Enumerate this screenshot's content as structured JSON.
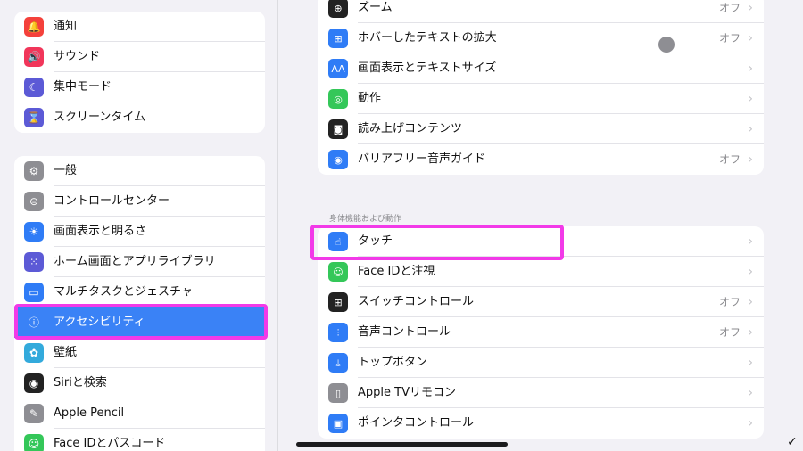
{
  "colors": {
    "accent": "#3a82f6",
    "highlight": "#f23ae8",
    "background": "#f2f1f6"
  },
  "sidebar": {
    "group1": [
      {
        "label": "通知",
        "icon": "bell-icon",
        "color": "#f4413b",
        "glyph": "🔔"
      },
      {
        "label": "サウンド",
        "icon": "speaker-icon",
        "color": "#f1365a",
        "glyph": "🔊"
      },
      {
        "label": "集中モード",
        "icon": "moon-icon",
        "color": "#5c5ad6",
        "glyph": "☾"
      },
      {
        "label": "スクリーンタイム",
        "icon": "hourglass-icon",
        "color": "#5c5ad6",
        "glyph": "⌛"
      }
    ],
    "group2": [
      {
        "label": "一般",
        "icon": "gear-icon",
        "color": "#8e8e93",
        "glyph": "⚙"
      },
      {
        "label": "コントロールセンター",
        "icon": "toggles-icon",
        "color": "#8e8e93",
        "glyph": "⊜"
      },
      {
        "label": "画面表示と明るさ",
        "icon": "sun-icon",
        "color": "#2f7cf6",
        "glyph": "☀"
      },
      {
        "label": "ホーム画面とアプリライブラリ",
        "icon": "app-grid-icon",
        "color": "#5c5ad6",
        "glyph": "⁙"
      },
      {
        "label": "マルチタスクとジェスチャ",
        "icon": "multitask-icon",
        "color": "#2f7cf6",
        "glyph": "▭"
      },
      {
        "label": "アクセシビリティ",
        "icon": "accessibility-icon",
        "color": "#2f7cf6",
        "glyph": "ⓘ",
        "selected": true
      },
      {
        "label": "壁紙",
        "icon": "flower-icon",
        "color": "#33aadc",
        "glyph": "✿"
      },
      {
        "label": "Siriと検索",
        "icon": "siri-icon",
        "color": "#222222",
        "glyph": "◉"
      },
      {
        "label": "Apple Pencil",
        "icon": "pencil-icon",
        "color": "#8e8e93",
        "glyph": "✎"
      },
      {
        "label": "Face IDとパスコード",
        "icon": "faceid-icon",
        "color": "#34c759",
        "glyph": "☺"
      }
    ]
  },
  "main": {
    "vision_group": [
      {
        "label": "ズーム",
        "icon": "zoom-icon",
        "color": "#222222",
        "glyph": "⊕",
        "value": "オフ"
      },
      {
        "label": "ホバーしたテキストの拡大",
        "icon": "hover-text-icon",
        "color": "#2f7cf6",
        "glyph": "⊞",
        "value": "オフ"
      },
      {
        "label": "画面表示とテキストサイズ",
        "icon": "text-size-icon",
        "color": "#2f7cf6",
        "glyph": "AA",
        "value": ""
      },
      {
        "label": "動作",
        "icon": "motion-icon",
        "color": "#34c759",
        "glyph": "◎",
        "value": ""
      },
      {
        "label": "読み上げコンテンツ",
        "icon": "speech-icon",
        "color": "#222222",
        "glyph": "◙",
        "value": ""
      },
      {
        "label": "バリアフリー音声ガイド",
        "icon": "audio-description-icon",
        "color": "#2f7cf6",
        "glyph": "◉",
        "value": "オフ"
      }
    ],
    "section_header": "身体機能および動作",
    "physical_group": [
      {
        "label": "タッチ",
        "icon": "touch-hand-icon",
        "color": "#2f7cf6",
        "glyph": "☝",
        "value": ""
      },
      {
        "label": "Face IDと注視",
        "icon": "faceid-icon",
        "color": "#34c759",
        "glyph": "☺",
        "value": ""
      },
      {
        "label": "スイッチコントロール",
        "icon": "switch-grid-icon",
        "color": "#222222",
        "glyph": "⊞",
        "value": "オフ"
      },
      {
        "label": "音声コントロール",
        "icon": "voice-wave-icon",
        "color": "#2f7cf6",
        "glyph": "⫶",
        "value": "オフ"
      },
      {
        "label": "トップボタン",
        "icon": "top-button-icon",
        "color": "#2f7cf6",
        "glyph": "⤓",
        "value": ""
      },
      {
        "label": "Apple TVリモコン",
        "icon": "remote-icon",
        "color": "#8e8e93",
        "glyph": "▯",
        "value": ""
      },
      {
        "label": "ポインタコントロール",
        "icon": "pointer-icon",
        "color": "#2f7cf6",
        "glyph": "▣",
        "value": ""
      }
    ]
  }
}
